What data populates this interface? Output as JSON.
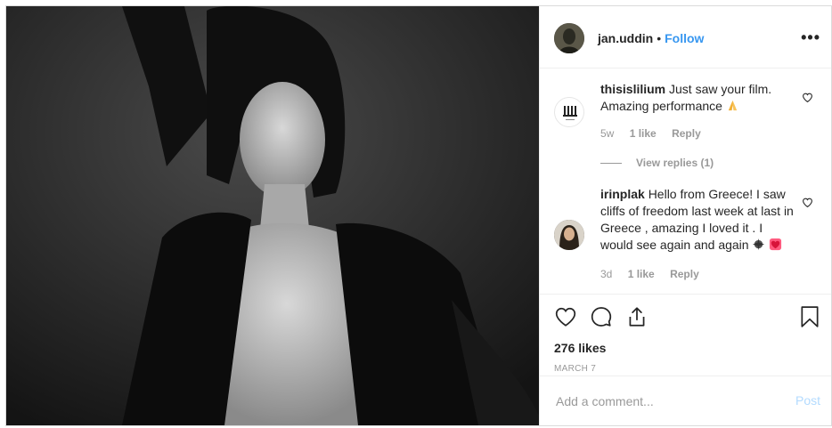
{
  "post": {
    "author": {
      "username": "jan.uddin",
      "separator": "•",
      "follow_label": "Follow"
    },
    "more_icon": "more-options-icon",
    "comments": [
      {
        "username": "thisislilium",
        "text": "Just saw your film. Amazing performance",
        "emoji": "folded-hands-emoji",
        "time": "5w",
        "likes": "1 like",
        "reply_label": "Reply",
        "view_replies": "View replies (1)",
        "avatar_logo": "LILI"
      },
      {
        "username": "irinplak",
        "text": "Hello from Greece! I saw cliffs of freedom last week at last in Greece , amazing I loved it . I would see again and again",
        "emoji": "sparkle-and-heart-emoji",
        "time": "3d",
        "likes": "1 like",
        "reply_label": "Reply"
      }
    ],
    "likes_count": "276 likes",
    "date": "MARCH 7",
    "add_comment": {
      "placeholder": "Add a comment...",
      "post_label": "Post"
    },
    "icons": [
      "heart-icon",
      "comment-icon",
      "share-icon",
      "bookmark-icon"
    ]
  }
}
